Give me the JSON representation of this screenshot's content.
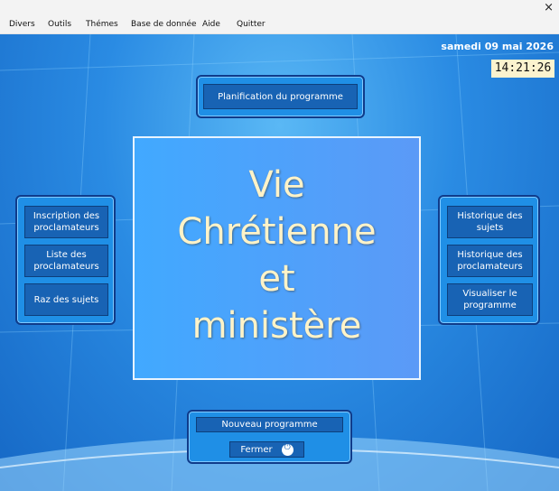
{
  "window": {
    "close_glyph": "×"
  },
  "menu": [
    "Divers",
    "Outils",
    "Thémes",
    "Base de donnée",
    "Aide",
    "Quitter"
  ],
  "header": {
    "date": "samedi 09 mai 2026",
    "time": "14:21:26"
  },
  "top_button": "Planification du programme",
  "main_title": "Vie\nChrétienne\net\nministère",
  "left_panel": [
    "Inscription des\nproclamateurs",
    "Liste des\nproclamateurs",
    "Raz des sujets"
  ],
  "right_panel": [
    "Historique des\nsujets",
    "Historique des\nproclamateurs",
    "Visualiser le\nprogramme"
  ],
  "bottom": {
    "new_program": "Nouveau programme",
    "close": "Fermer"
  }
}
